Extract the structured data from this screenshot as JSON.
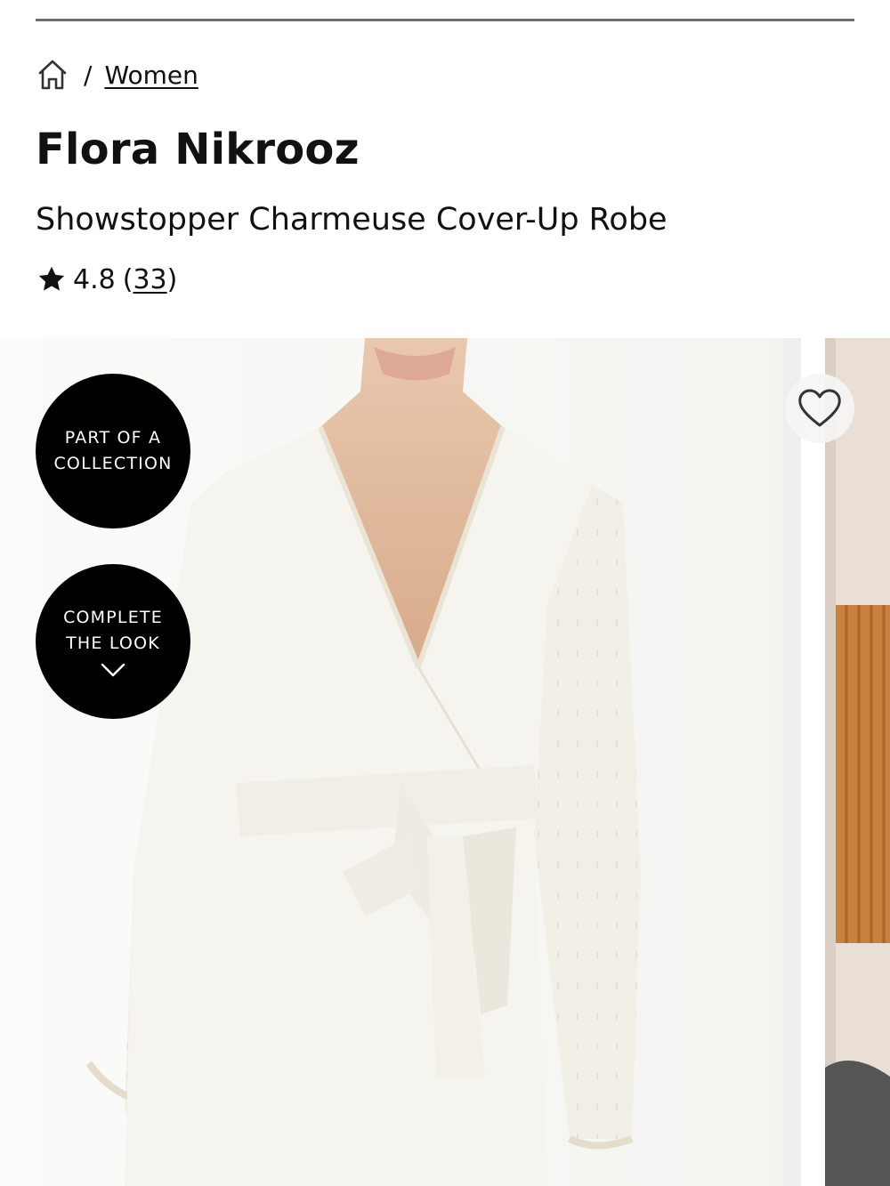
{
  "breadcrumb": {
    "home_icon": "home-icon",
    "separator": "/",
    "category": "Women"
  },
  "product": {
    "brand": "Flora Nikrooz",
    "name": "Showstopper Charmeuse Cover-Up Robe",
    "rating": "4.8",
    "review_count_open": "(",
    "review_count": "33",
    "review_count_close": ")",
    "star_icon": "star-icon"
  },
  "badges": {
    "collection_line1": "PART OF A",
    "collection_line2": "COLLECTION",
    "look_line1": "COMPLETE",
    "look_line2": "THE LOOK",
    "look_icon": "chevron-down-icon"
  },
  "wishlist": {
    "icon": "heart-icon"
  },
  "colors": {
    "badge_bg": "#000000",
    "text": "#111111",
    "robe": "#f6f4ee"
  }
}
